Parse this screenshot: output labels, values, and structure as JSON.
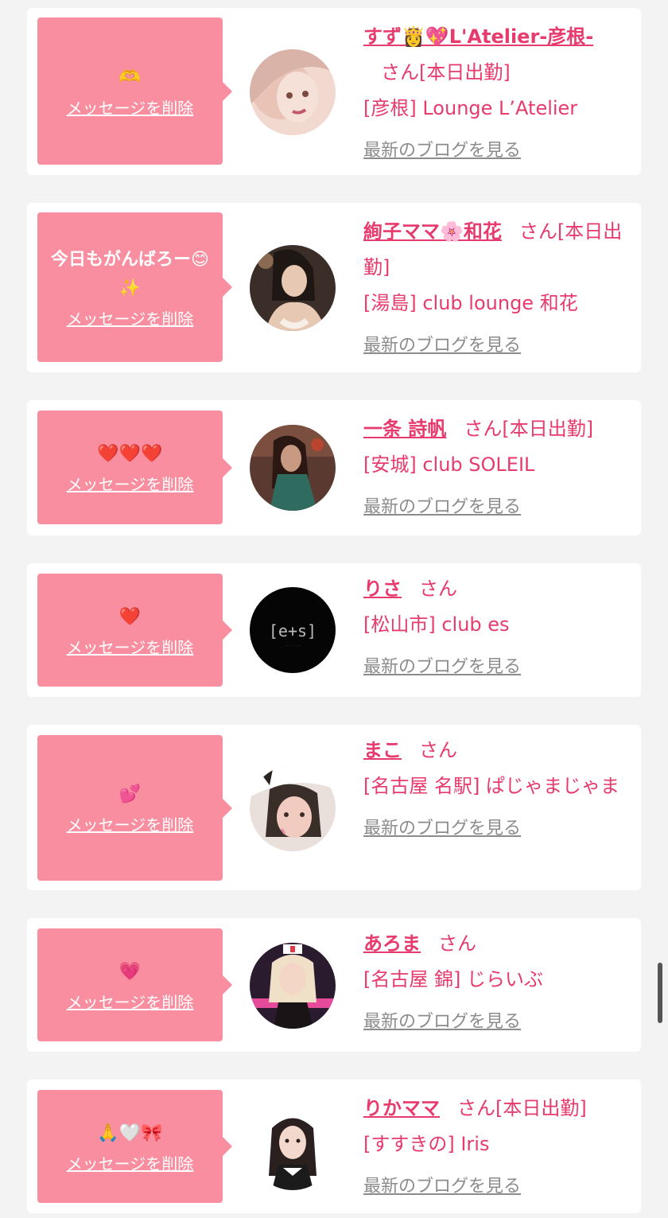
{
  "delete_label": "メッセージを削除",
  "san_label": "さん",
  "blog_label": "最新のブログを見る",
  "cards": [
    {
      "message": "🫶",
      "name": "すず👸💖L'Atelier-彦根-",
      "status": "[本日出勤]",
      "shop": "[彦根] Lounge L’Atelier",
      "avatar_colors": [
        "#d9b3a8",
        "#f1d9cf",
        "#a67366"
      ]
    },
    {
      "message": "今日もがんばろー😊✨",
      "name": "絢子ママ🌸和花",
      "status": "[本日出勤]",
      "shop": "[湯島] club lounge 和花",
      "avatar_colors": [
        "#3b2e28",
        "#e7c8b3",
        "#1e1714"
      ]
    },
    {
      "message": "❤️❤️❤️",
      "name": "一条 詩帆",
      "status": "[本日出勤]",
      "shop": "[安城] club SOLEIL",
      "avatar_colors": [
        "#5a3a30",
        "#2f6b5e",
        "#c89a82"
      ]
    },
    {
      "message": "❤️",
      "name": "りさ",
      "status": "",
      "shop": "[松山市] club es",
      "avatar_colors": [
        "#050505",
        "#050505",
        "#bbbbbb"
      ],
      "avatar_text": "[e+s]"
    },
    {
      "message": "💕",
      "name": "まこ",
      "status": "",
      "shop": "[名古屋 名駅] ぱじゃまじゃま",
      "avatar_colors": [
        "#e9e0dc",
        "#2a2320",
        "#f1cbbf"
      ]
    },
    {
      "message": "💗",
      "name": "あろま",
      "status": "",
      "shop": "[名古屋 錦] じらいぶ",
      "avatar_colors": [
        "#2a1b2e",
        "#e64a9a",
        "#f4d6c6"
      ]
    },
    {
      "message": "🙏🤍🎀",
      "name": "りかママ",
      "status": "[本日出勤]",
      "shop": "[すすきの] Iris",
      "avatar_colors": [
        "#ffffff",
        "#2b2020",
        "#f3d8cc"
      ]
    }
  ]
}
